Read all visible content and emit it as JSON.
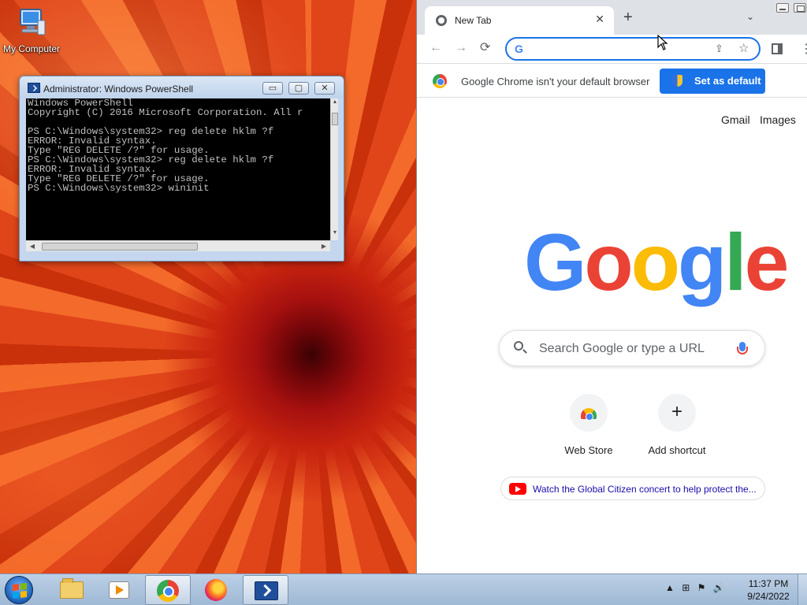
{
  "desktop": {
    "icons": [
      {
        "label": "My Computer",
        "icon": "computer-icon"
      }
    ]
  },
  "powershell": {
    "title": "Administrator: Windows PowerShell",
    "buttons": {
      "minimize": "▭",
      "maximize": "▢",
      "close": "✕"
    },
    "console_text": "Windows PowerShell\nCopyright (C) 2016 Microsoft Corporation. All r\n\nPS C:\\Windows\\system32> reg delete hklm ?f\nERROR: Invalid syntax.\nType \"REG DELETE /?\" for usage.\nPS C:\\Windows\\system32> reg delete hklm ?f\nERROR: Invalid syntax.\nType \"REG DELETE /?\" for usage.\nPS C:\\Windows\\system32> wininit"
  },
  "chrome": {
    "tab_title": "New Tab",
    "tab_close": "✕",
    "new_tab": "+",
    "tab_list": "⌄",
    "toolbar": {
      "back": "←",
      "forward": "→",
      "reload": "⟳",
      "menu": "⋮"
    },
    "omnibox": {
      "value": "",
      "g_glyph": "G",
      "share": "⇪",
      "star": "☆"
    },
    "infobar": {
      "message": "Google Chrome isn't your default browser",
      "button": "Set as default"
    },
    "links": {
      "gmail": "Gmail",
      "images": "Images"
    },
    "logo_letters": [
      "G",
      "o",
      "o",
      "g",
      "l",
      "e"
    ],
    "search_placeholder": "Search Google or type a URL",
    "shortcuts": [
      {
        "label": "Web Store",
        "icon": "web-store-icon"
      },
      {
        "label": "Add shortcut",
        "icon": "plus-icon",
        "glyph": "+"
      }
    ],
    "promo": "Watch the Global Citizen concert to help protect the..."
  },
  "taskbar": {
    "pinned": [
      {
        "name": "explorer",
        "icon": "folder-icon"
      },
      {
        "name": "media-player",
        "icon": "media-player-icon"
      },
      {
        "name": "chrome",
        "icon": "chrome-icon",
        "active": true
      },
      {
        "name": "firefox",
        "icon": "firefox-icon"
      },
      {
        "name": "powershell",
        "icon": "powershell-icon",
        "active": true
      }
    ],
    "tray": {
      "up_arrow": "▲",
      "network": "⊞",
      "flag": "⚑",
      "volume": "🔊"
    },
    "time": "11:37 PM",
    "date": "9/24/2022"
  }
}
